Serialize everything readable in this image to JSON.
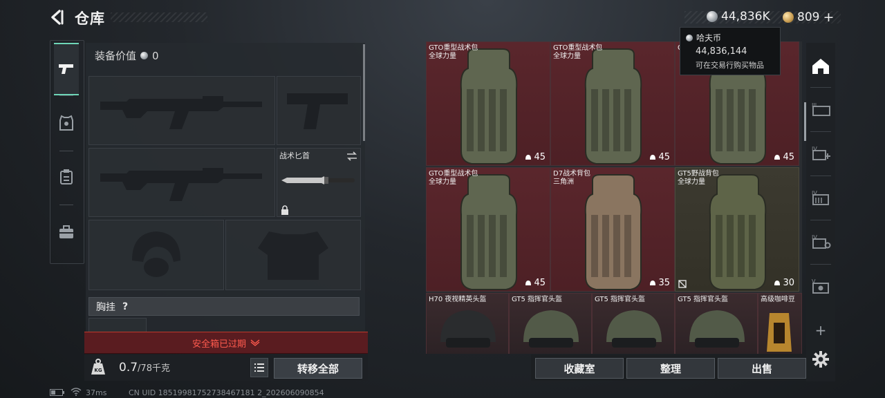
{
  "header": {
    "title": "仓库",
    "silver_amount": "44,836K",
    "gold_amount": "809",
    "gold_plus": "+"
  },
  "tooltip": {
    "name": "哈夫币",
    "amount": "44,836,144",
    "description": "可在交易行购买物品"
  },
  "left_tabs": [
    {
      "icon": "pistol-icon",
      "active": true
    },
    {
      "icon": "armor-vest-icon",
      "active": false
    },
    {
      "icon": "clipboard-icon",
      "active": false
    },
    {
      "icon": "briefcase-icon",
      "active": false
    }
  ],
  "equipment": {
    "value_label": "装备价值",
    "value": "0",
    "knife_label": "战术匕首",
    "chest_rig_label": "胸挂",
    "chest_rig_help": "?",
    "expired_text": "安全箱已过期",
    "weight_value": "0.7",
    "weight_max": "/78千克",
    "weight_icon_text": "KG",
    "transfer_all": "转移全部"
  },
  "storage": {
    "items": [
      {
        "name": "GTO重型战术包",
        "sub": "全球力量",
        "qty": "45",
        "bg": "red",
        "bag": "#5f6650"
      },
      {
        "name": "GTO重型战术包",
        "sub": "全球力量",
        "qty": "45",
        "bg": "red",
        "bag": "#5f6650"
      },
      {
        "name": "GTO重型战术包",
        "sub": "",
        "qty": "45",
        "bg": "red",
        "bag": "#5f6650"
      },
      {
        "name": "GTO重型战术包",
        "sub": "全球力量",
        "qty": "45",
        "bg": "red",
        "bag": "#5f6650"
      },
      {
        "name": "D7战术背包",
        "sub": "三角洲",
        "qty": "35",
        "bg": "red",
        "bag": "#8a7560"
      },
      {
        "name": "GT5野战背包",
        "sub": "全球力量",
        "qty": "30",
        "bg": "olive",
        "bag": "#5e6448"
      },
      {
        "name": "H70 夜视精英头盔",
        "sub": "",
        "qty": "",
        "bg": "dark",
        "bag": "#2a2c2e"
      },
      {
        "name": "GT5 指挥官头盔",
        "sub": "",
        "qty": "",
        "bg": "dark",
        "bag": "#525a48"
      },
      {
        "name": "GT5 指挥官头盔",
        "sub": "",
        "qty": "",
        "bg": "dark",
        "bag": "#525a48"
      },
      {
        "name": "GT5 指挥官头盔",
        "sub": "",
        "qty": "",
        "bg": "dark",
        "bag": "#525a48"
      },
      {
        "name": "高级咖啡豆",
        "sub": "",
        "qty": "",
        "bg": "dark",
        "bag": "#b8862e"
      }
    ]
  },
  "bottom_buttons": {
    "collection": "收藏室",
    "sort": "整理",
    "sell": "出售"
  },
  "right_sidebar": [
    {
      "icon": "home-icon"
    },
    {
      "icon": "storage-tier-3-icon",
      "label": "III"
    },
    {
      "icon": "storage-tier-4-add-icon",
      "label": "IV"
    },
    {
      "icon": "storage-tier-4-icon",
      "label": "IV"
    },
    {
      "icon": "storage-tier-4-settings-icon",
      "label": "IV"
    },
    {
      "icon": "storage-tier-5-icon",
      "label": "V"
    },
    {
      "icon": "add-icon",
      "label": "+"
    },
    {
      "icon": "gear-icon"
    }
  ],
  "status_bar": {
    "ping": "37ms",
    "uid": "CN UID 18519981752738467181 2_202606090854"
  },
  "colors": {
    "accent": "#6fd7b8",
    "alert": "#ff5a4e",
    "cell_red": "#5a262c"
  }
}
